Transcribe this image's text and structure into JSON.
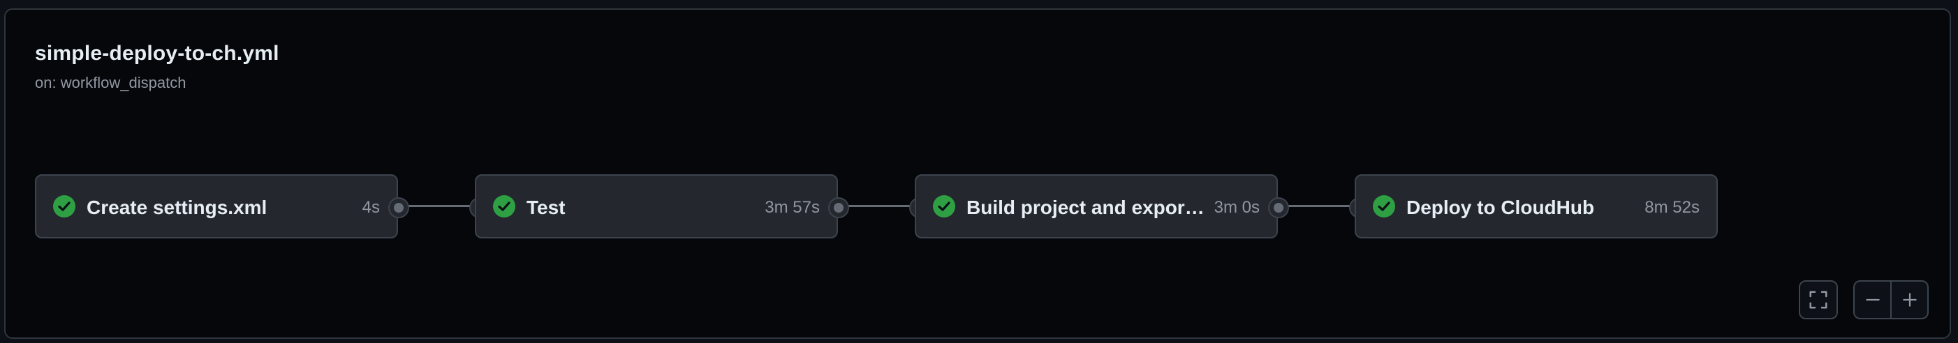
{
  "workflow": {
    "title": "simple-deploy-to-ch.yml",
    "trigger": "on: workflow_dispatch"
  },
  "jobs": [
    {
      "name": "Create settings.xml",
      "duration": "4s",
      "status": "success"
    },
    {
      "name": "Test",
      "duration": "3m 57s",
      "status": "success"
    },
    {
      "name": "Build project and export artifact",
      "duration": "3m 0s",
      "status": "success"
    },
    {
      "name": "Deploy to CloudHub",
      "duration": "8m 52s",
      "status": "success"
    }
  ],
  "controls": {
    "fullscreen_icon": "fullscreen-icon",
    "zoom_out_icon": "minus-icon",
    "zoom_in_icon": "plus-icon"
  },
  "colors": {
    "success": "#3fb950",
    "success_bg": "#2ea043",
    "background": "#05070b",
    "card": "#24272e",
    "border": "#3d444d"
  }
}
